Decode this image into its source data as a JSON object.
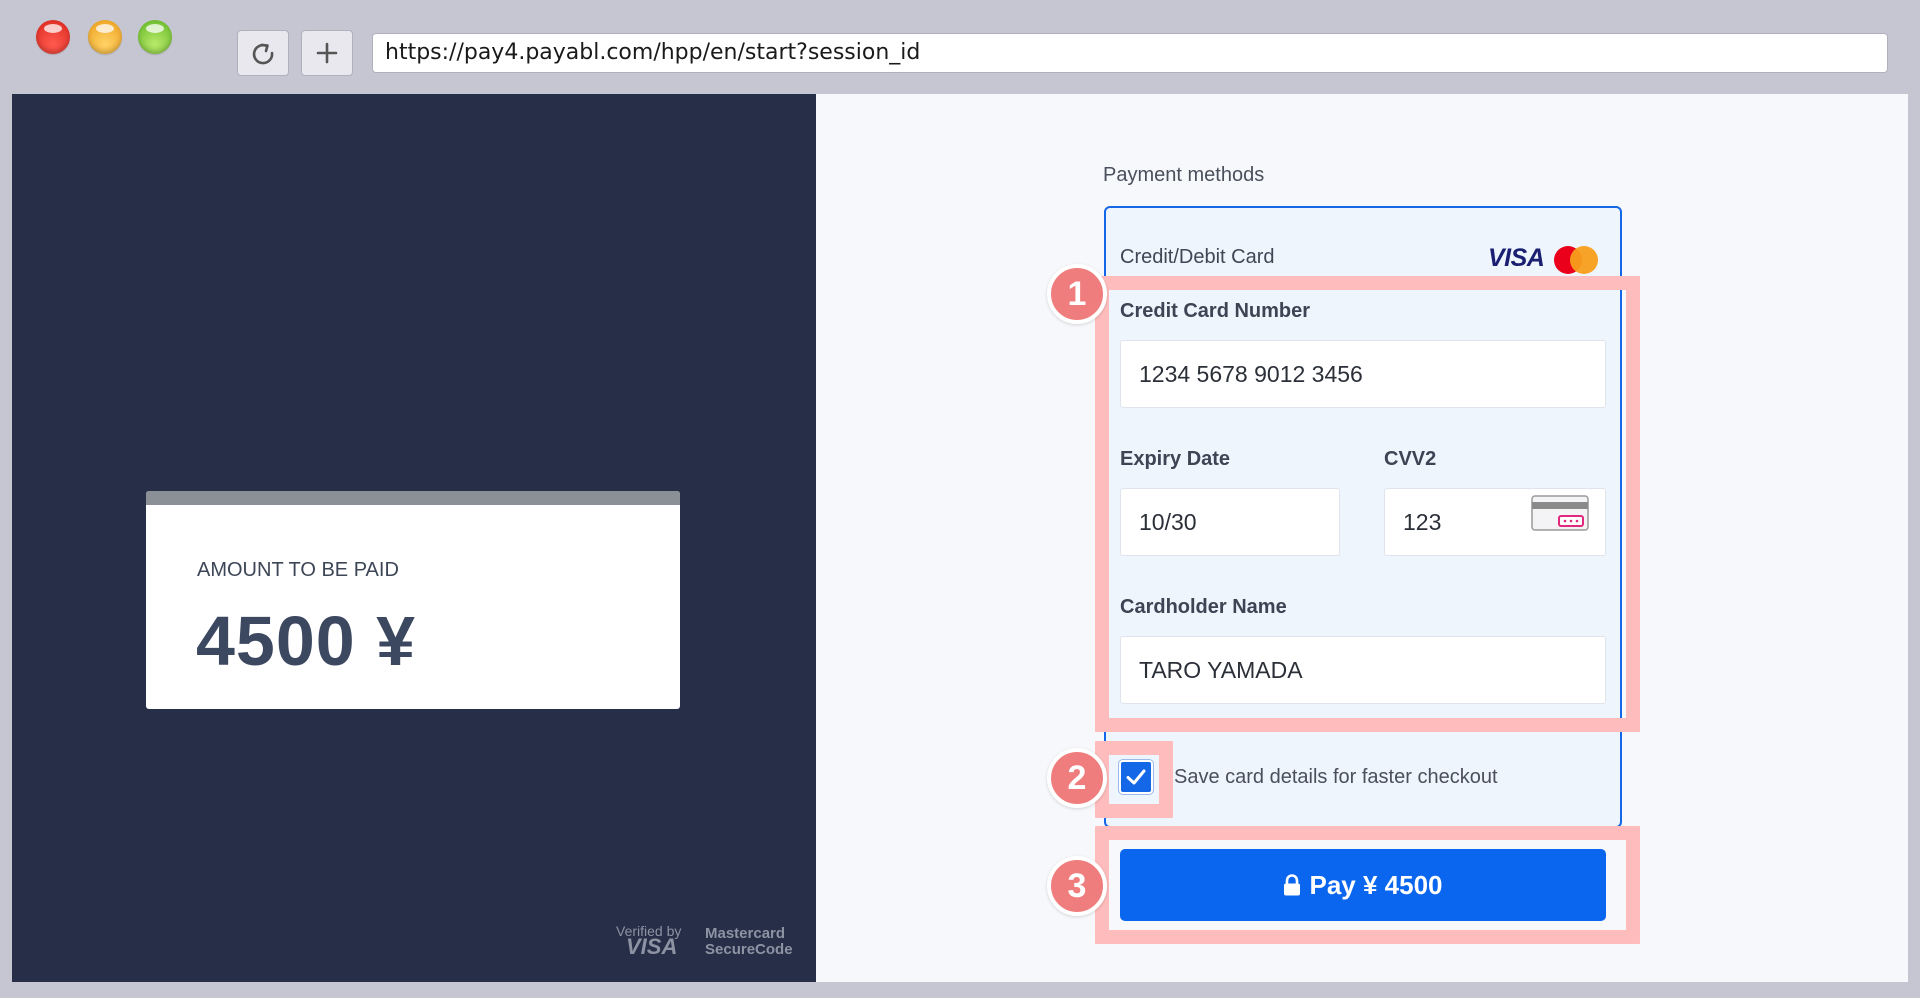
{
  "browser": {
    "url": "https://pay4.payabl.com/hpp/en/start?session_id"
  },
  "summary": {
    "amount_label": "AMOUNT TO BE PAID",
    "amount_value": "4500 ¥"
  },
  "trust": {
    "verified_by": "Verified by",
    "visa": "VISA",
    "mastercard_line1": "Mastercard",
    "mastercard_line2": "SecureCode"
  },
  "payment": {
    "title": "Payment methods",
    "method_label": "Credit/Debit Card",
    "visa_logo": "VISA",
    "card_number_label": "Credit Card Number",
    "card_number_value": "1234 5678 9012 3456",
    "expiry_label": "Expiry Date",
    "expiry_value": "10/30",
    "cvv_label": "CVV2",
    "cvv_value": "123",
    "name_label": "Cardholder Name",
    "name_value": "TARO YAMADA",
    "save_label": "Save card details for faster checkout",
    "save_checked": true,
    "pay_label": "Pay ¥ 4500"
  },
  "annotations": [
    "1",
    "2",
    "3"
  ],
  "colors": {
    "left_panel": "#272e47",
    "accent": "#0a66ee",
    "highlight": "#ffbcbc",
    "badge": "#f07d7d"
  }
}
